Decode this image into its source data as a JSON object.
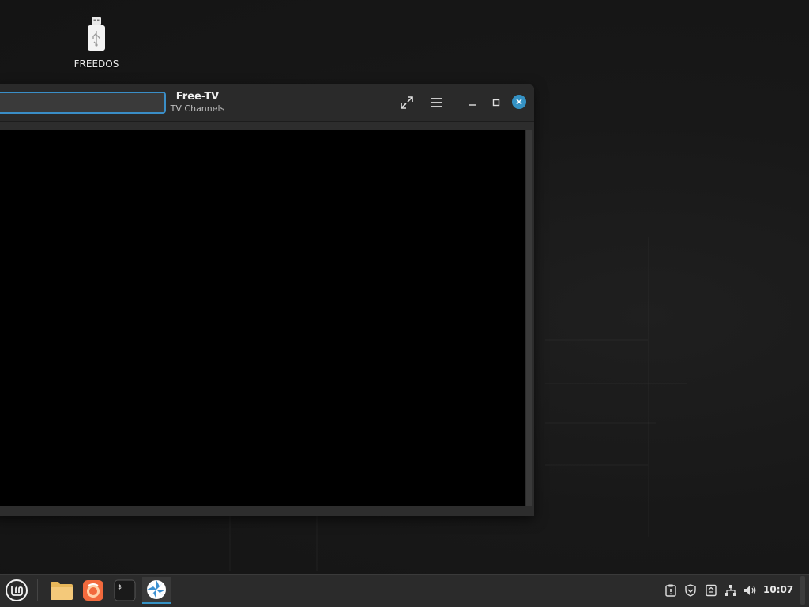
{
  "desktop": {
    "icon_label": "FREEDOS"
  },
  "window": {
    "title": "Free-TV",
    "subtitle": "TV Channels",
    "search_value": ""
  },
  "taskbar": {
    "clock": "10:07",
    "apps": [
      "menu-icon",
      "files-icon",
      "firefox-icon",
      "terminal-icon",
      "free-tv-icon"
    ]
  },
  "colors": {
    "accent": "#3592c4",
    "window_bg": "#2d2d2d",
    "video_bg": "#000000"
  }
}
